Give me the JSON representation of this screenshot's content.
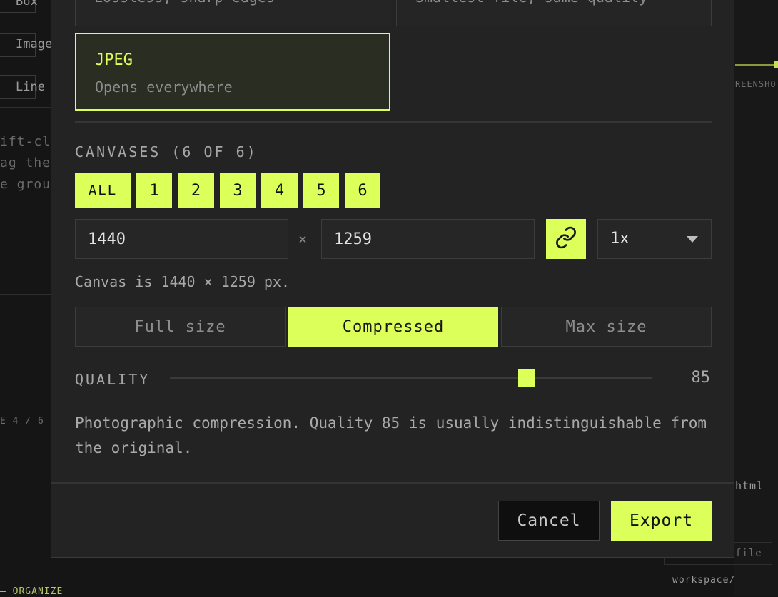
{
  "background": {
    "left_items": [
      "Box",
      "Image",
      "Line"
    ],
    "left_texts": [
      "ift-cli",
      "ag them",
      "e group"
    ],
    "page_indicator": "E 4 / 6",
    "organize_label": "ORGANIZE",
    "right_labels": [
      "REENSHO",
      "html",
      "file",
      "workspace/"
    ]
  },
  "format_options": [
    {
      "title": "",
      "desc": "Lossless, sharp edges",
      "selected": false
    },
    {
      "title": "",
      "desc": "Smallest file, same quality",
      "selected": false
    },
    {
      "title": "JPEG",
      "desc": "Opens everywhere",
      "selected": true
    }
  ],
  "canvases": {
    "label": "CANVASES (6 OF 6)",
    "chips": [
      "ALL",
      "1",
      "2",
      "3",
      "4",
      "5",
      "6"
    ]
  },
  "size": {
    "width": "1440",
    "times": "×",
    "height": "1259",
    "scale": "1x",
    "hint": "Canvas is 1440 × 1259 px."
  },
  "compression": {
    "options": [
      "Full size",
      "Compressed",
      "Max size"
    ],
    "active": "Compressed"
  },
  "quality": {
    "label": "QUALITY",
    "value": "85",
    "fraction": 0.74,
    "description": "Photographic compression. Quality 85 is usually indistinguishable from the original."
  },
  "footer": {
    "cancel": "Cancel",
    "export": "Export"
  },
  "colors": {
    "accent": "#dcff5a",
    "modal_bg": "#232323"
  },
  "icons": {
    "link": "link-icon",
    "caret": "chevron-down-icon"
  }
}
